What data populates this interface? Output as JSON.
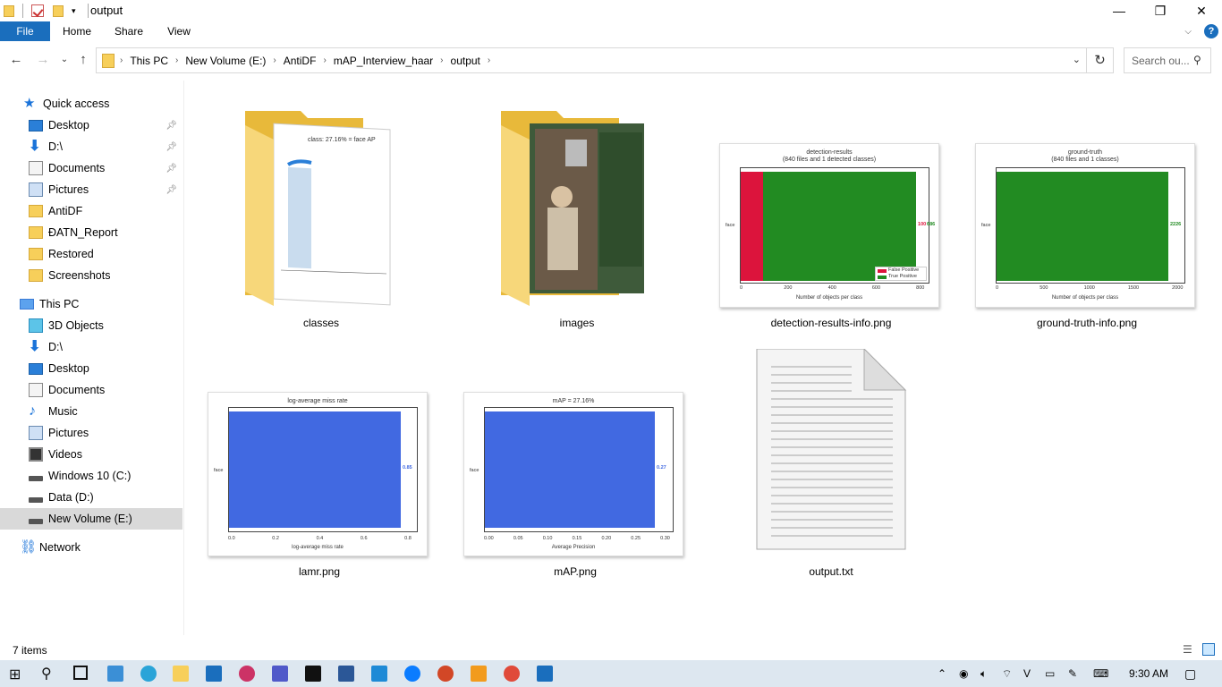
{
  "window": {
    "title": "output",
    "minimize": "—",
    "restore": "❐",
    "close": "✕"
  },
  "ribbon": {
    "tabs": [
      "File",
      "Home",
      "Share",
      "View"
    ],
    "help": "?"
  },
  "address": {
    "crumbs": [
      "This PC",
      "New Volume (E:)",
      "AntiDF",
      "mAP_Interview_haar",
      "output"
    ],
    "search_placeholder": "Search ou..."
  },
  "sidebar": {
    "quick_access": "Quick access",
    "quick_items": [
      "Desktop",
      "D:\\",
      "Documents",
      "Pictures",
      "AntiDF",
      "ĐATN_Report",
      "Restored",
      "Screenshots"
    ],
    "this_pc": "This PC",
    "pc_items": [
      "3D Objects",
      "D:\\",
      "Desktop",
      "Documents",
      "Music",
      "Pictures",
      "Videos",
      "Windows 10 (C:)",
      "Data (D:)",
      "New Volume (E:)"
    ],
    "network": "Network"
  },
  "files": {
    "classes": "classes",
    "images": "images",
    "detection": "detection-results-info.png",
    "groundtruth": "ground-truth-info.png",
    "lamr": "lamr.png",
    "map": "mAP.png",
    "output": "output.txt"
  },
  "thumbs": {
    "classes_title": "class: 27.16% = face AP",
    "detection": {
      "title": "detection-results",
      "subtitle": "(840 files and 1 detected classes)",
      "ylabel": "face",
      "fp": 100,
      "tp": 686,
      "fp_label": "100",
      "tp_label": "686",
      "legend_fp": "False Positive",
      "legend_tp": "True Positive",
      "xlabel": "Number of objects per class",
      "ticks": [
        "0",
        "200",
        "400",
        "600",
        "800"
      ],
      "colors": {
        "fp": "#dc143c",
        "tp": "#228b22"
      }
    },
    "groundtruth": {
      "title": "ground-truth",
      "subtitle": "(840 files and 1 classes)",
      "ylabel": "face",
      "value_label": "2226",
      "xlabel": "Number of objects per class",
      "ticks": [
        "0",
        "500",
        "1000",
        "1500",
        "2000"
      ]
    },
    "lamr": {
      "title": "log-average miss rate",
      "ylabel": "face",
      "value_label": "0.85",
      "xlabel": "log-average miss rate",
      "ticks": [
        "0.0",
        "0.2",
        "0.4",
        "0.6",
        "0.8"
      ]
    },
    "map": {
      "title": "mAP = 27.16%",
      "ylabel": "face",
      "value_label": "0.27",
      "xlabel": "Average Precision",
      "ticks": [
        "0.00",
        "0.05",
        "0.10",
        "0.15",
        "0.20",
        "0.25",
        "0.30"
      ]
    }
  },
  "status": {
    "items": "7 items"
  },
  "taskbar": {
    "time": "9:30 AM"
  }
}
